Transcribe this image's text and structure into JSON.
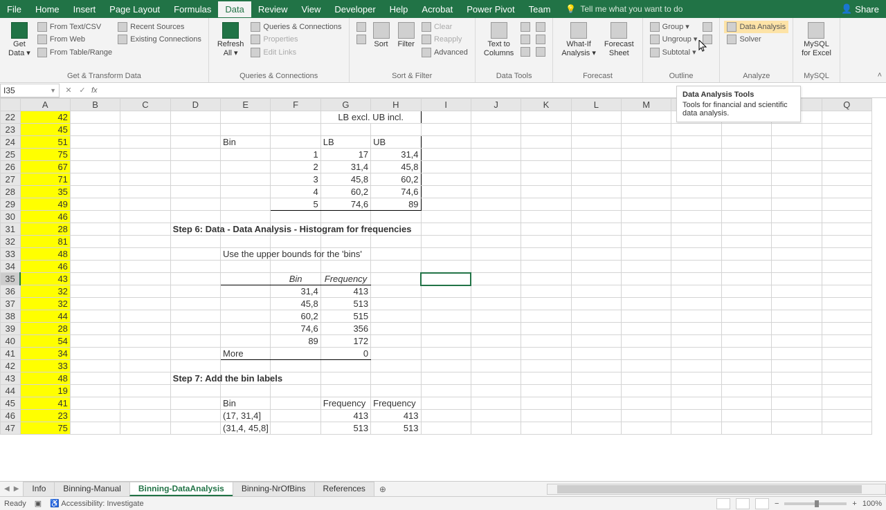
{
  "titlebar": {
    "menus": [
      "File",
      "Home",
      "Insert",
      "Page Layout",
      "Formulas",
      "Data",
      "Review",
      "View",
      "Developer",
      "Help",
      "Acrobat",
      "Power Pivot",
      "Team"
    ],
    "active_menu": 5,
    "search_placeholder": "Tell me what you want to do",
    "share_label": "Share"
  },
  "ribbon": {
    "groups": [
      {
        "label": "Get & Transform Data",
        "large": [
          {
            "name": "get-data",
            "label": "Get\nData"
          }
        ],
        "small": [
          {
            "name": "from-text-csv",
            "label": "From Text/CSV"
          },
          {
            "name": "from-web",
            "label": "From Web"
          },
          {
            "name": "from-table",
            "label": "From Table/Range"
          },
          {
            "name": "recent-sources",
            "label": "Recent Sources"
          },
          {
            "name": "existing-conn",
            "label": "Existing Connections"
          }
        ]
      },
      {
        "label": "Queries & Connections",
        "large": [
          {
            "name": "refresh-all",
            "label": "Refresh\nAll"
          }
        ],
        "small": [
          {
            "name": "queries-conn",
            "label": "Queries & Connections"
          },
          {
            "name": "properties",
            "label": "Properties",
            "disabled": true
          },
          {
            "name": "edit-links",
            "label": "Edit Links",
            "disabled": true
          }
        ]
      },
      {
        "label": "Sort & Filter",
        "large": [
          {
            "name": "sort",
            "label": "Sort"
          },
          {
            "name": "filter",
            "label": "Filter"
          }
        ],
        "small": [
          {
            "name": "clear",
            "label": "Clear",
            "disabled": true
          },
          {
            "name": "reapply",
            "label": "Reapply",
            "disabled": true
          },
          {
            "name": "advanced",
            "label": "Advanced"
          }
        ]
      },
      {
        "label": "Data Tools",
        "large": [
          {
            "name": "text-to-columns",
            "label": "Text to\nColumns"
          }
        ],
        "small_icons": 6
      },
      {
        "label": "Forecast",
        "large": [
          {
            "name": "what-if",
            "label": "What-If\nAnalysis"
          },
          {
            "name": "forecast-sheet",
            "label": "Forecast\nSheet"
          }
        ]
      },
      {
        "label": "Outline",
        "small": [
          {
            "name": "group",
            "label": "Group"
          },
          {
            "name": "ungroup",
            "label": "Ungroup"
          },
          {
            "name": "subtotal",
            "label": "Subtotal"
          }
        ]
      },
      {
        "label": "Analyze",
        "small": [
          {
            "name": "data-analysis",
            "label": "Data Analysis",
            "highlight": true
          },
          {
            "name": "solver",
            "label": "Solver"
          }
        ]
      },
      {
        "label": "MySQL",
        "large": [
          {
            "name": "mysql-excel",
            "label": "MySQL\nfor Excel"
          }
        ]
      }
    ]
  },
  "tooltip": {
    "title": "Data Analysis Tools",
    "text": "Tools for financial and scientific data analysis."
  },
  "name_box": "I35",
  "columns": [
    "A",
    "B",
    "C",
    "D",
    "E",
    "F",
    "G",
    "H",
    "I",
    "J",
    "K",
    "L",
    "M",
    "N",
    "O",
    "P",
    "Q"
  ],
  "row_start": 22,
  "colA_values": [
    42,
    45,
    51,
    75,
    67,
    71,
    35,
    49,
    46,
    28,
    81,
    48,
    46,
    43,
    32,
    32,
    44,
    28,
    54,
    34,
    33,
    48,
    19,
    41,
    23,
    75
  ],
  "bin_table": {
    "merged_header": "LB excl. UB incl.",
    "col_bin": "Bin",
    "col_lb": "LB",
    "col_ub": "UB",
    "rows": [
      {
        "bin": 1,
        "lb": "17",
        "ub": "31,4"
      },
      {
        "bin": 2,
        "lb": "31,4",
        "ub": "45,8"
      },
      {
        "bin": 3,
        "lb": "45,8",
        "ub": "60,2"
      },
      {
        "bin": 4,
        "lb": "60,2",
        "ub": "74,6"
      },
      {
        "bin": 5,
        "lb": "74,6",
        "ub": "89"
      }
    ]
  },
  "step6_title": "Step 6: Data - Data Analysis - Histogram for frequencies",
  "step6_note": "Use the upper bounds for the 'bins'",
  "freq_table": {
    "col_bin": "Bin",
    "col_freq": "Frequency",
    "rows": [
      {
        "bin": "31,4",
        "freq": 413
      },
      {
        "bin": "45,8",
        "freq": 513
      },
      {
        "bin": "60,2",
        "freq": 515
      },
      {
        "bin": "74,6",
        "freq": 356
      },
      {
        "bin": "89",
        "freq": 172
      }
    ],
    "more_label": "More",
    "more_val": 0
  },
  "step7_title": "Step 7: Add the bin labels",
  "label_table": {
    "col_bin": "Bin",
    "col_freq1": "Frequency",
    "col_freq2": "Frequency",
    "rows": [
      {
        "bin": "(17, 31,4]",
        "f1": 413,
        "f2": 413
      },
      {
        "bin": "(31,4, 45,8]",
        "f1": 513,
        "f2": 513
      }
    ]
  },
  "sheets": {
    "tabs": [
      "Info",
      "Binning-Manual",
      "Binning-DataAnalysis",
      "Binning-NrOfBins",
      "References"
    ],
    "active": 2
  },
  "status": {
    "ready": "Ready",
    "accessibility": "Accessibility: Investigate",
    "zoom": "100%"
  }
}
